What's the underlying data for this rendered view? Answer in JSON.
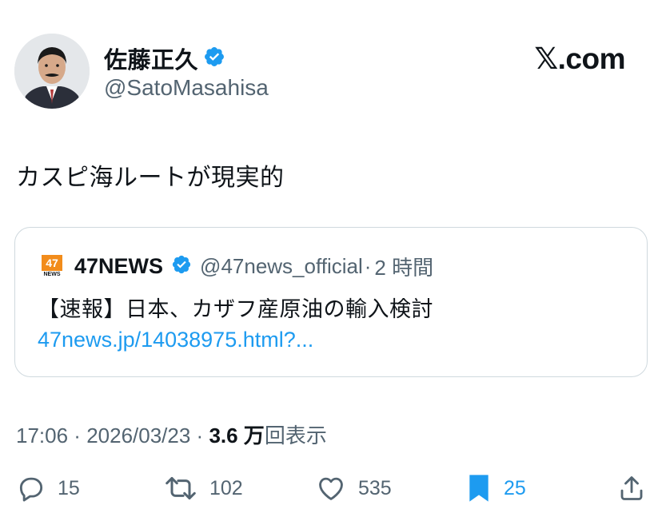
{
  "author": {
    "display_name": "佐藤正久",
    "handle": "@SatoMasahisa",
    "verified_icon": "verified-badge-icon",
    "avatar": "avatar-photo"
  },
  "brand": {
    "text": "𝕏.com"
  },
  "tweet": {
    "text": "カスピ海ルートが現実的"
  },
  "quote": {
    "logo_number": "47",
    "logo_sub": "NEWS",
    "name": "47NEWS",
    "handle": "@47news_official",
    "separator": "·",
    "time": "2 時間",
    "text": "【速報】日本、カザフ産原油の輸入検討",
    "link": "47news.jp/14038975.html?..."
  },
  "meta": {
    "time": "17:06",
    "sep1": " · ",
    "date": "2026/03/23",
    "sep2": " · ",
    "views_count": "3.6 万",
    "views_label": "回表示"
  },
  "actions": {
    "reply_count": "15",
    "repost_count": "102",
    "like_count": "535",
    "bookmark_count": "25"
  },
  "colors": {
    "accent": "#1d9bf0",
    "secondary_text": "#536471",
    "border": "#cfd9de",
    "primary_text": "#0f1419"
  }
}
